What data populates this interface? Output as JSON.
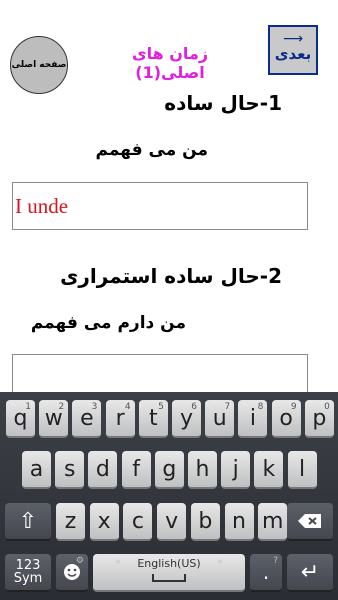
{
  "header": {
    "home_label": "صفحه اصلی",
    "title": "زمان های اصلی(1)",
    "next_label": "بعدی",
    "next_arrow_icon": "arrow-right-icon"
  },
  "sections": [
    {
      "heading": "1-حال ساده",
      "sentence": "من می فهمم",
      "answer_value": "I unde"
    },
    {
      "heading": "2-حال ساده استمراری",
      "sentence": "من دارم می فهمم",
      "answer_value": ""
    }
  ],
  "keyboard": {
    "row1": [
      {
        "key": "q",
        "hint": "1"
      },
      {
        "key": "w",
        "hint": "2"
      },
      {
        "key": "e",
        "hint": "3"
      },
      {
        "key": "r",
        "hint": "4"
      },
      {
        "key": "t",
        "hint": "5"
      },
      {
        "key": "y",
        "hint": "6"
      },
      {
        "key": "u",
        "hint": "7"
      },
      {
        "key": "i",
        "hint": "8"
      },
      {
        "key": "o",
        "hint": "9"
      },
      {
        "key": "p",
        "hint": "0"
      }
    ],
    "row2": [
      "a",
      "s",
      "d",
      "f",
      "g",
      "h",
      "j",
      "k",
      "l"
    ],
    "row3": [
      "z",
      "x",
      "c",
      "v",
      "b",
      "n",
      "m"
    ],
    "symbols_line1": "123",
    "symbols_line2": "Sym",
    "language_label": "English(US)",
    "emoji_hint": "⚙",
    "period_key": ".",
    "period_hint": "?",
    "colors": {
      "key_face": "#d8d8d8",
      "func_key": "#50545b",
      "keyboard_bg": "#33363c"
    }
  },
  "colors": {
    "title": "#e020e0",
    "next_button_text": "#0a2c8a",
    "answer_text": "#d8141e"
  }
}
